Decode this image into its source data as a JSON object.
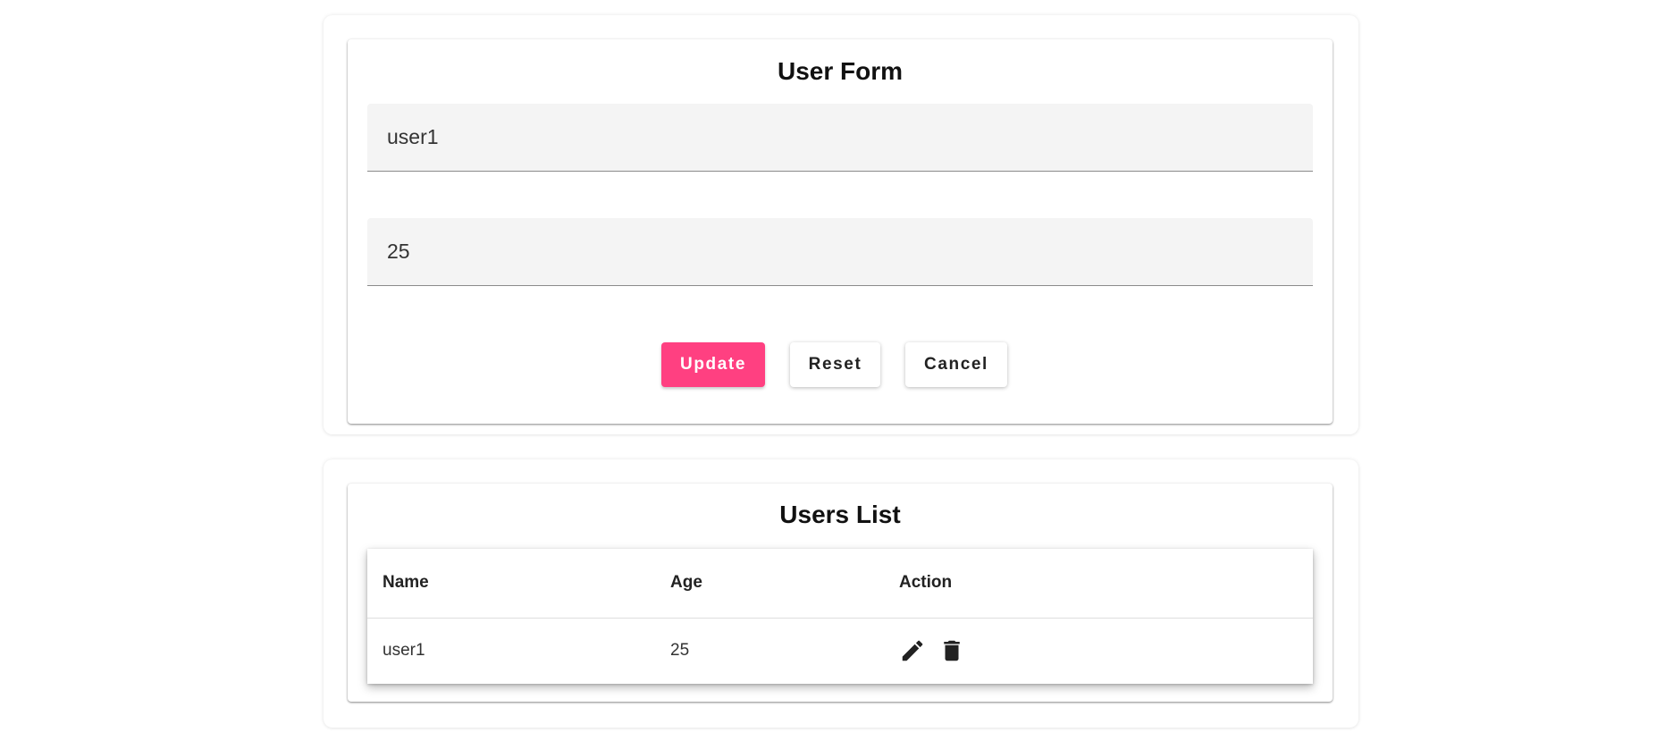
{
  "colors": {
    "accent": "#ff4081",
    "field_background": "#f4f4f4",
    "icon": "#222222"
  },
  "form": {
    "title": "User Form",
    "name_value": "user1",
    "age_value": "25",
    "buttons": {
      "update": "Update",
      "reset": "Reset",
      "cancel": "Cancel"
    }
  },
  "users_list": {
    "title": "Users List",
    "columns": [
      "Name",
      "Age",
      "Action"
    ],
    "rows": [
      {
        "name": "user1",
        "age": "25",
        "actions": [
          "edit-icon",
          "delete-icon"
        ]
      }
    ]
  }
}
